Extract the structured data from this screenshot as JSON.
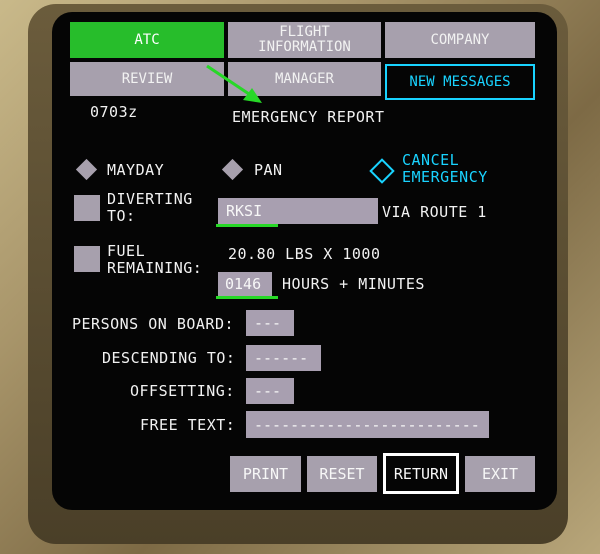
{
  "tabs": {
    "atc": "ATC",
    "flight_info_line1": "FLIGHT",
    "flight_info_line2": "INFORMATION",
    "company": "COMPANY",
    "review": "REVIEW",
    "manager": "MANAGER",
    "new_messages": "NEW MESSAGES"
  },
  "header": {
    "time": "0703z",
    "title": "EMERGENCY REPORT"
  },
  "options": {
    "mayday": "MAYDAY",
    "pan": "PAN",
    "cancel_line1": "CANCEL",
    "cancel_line2": "EMERGENCY"
  },
  "diverting": {
    "label_line1": "DIVERTING",
    "label_line2": "TO:",
    "value": "RKSI",
    "via": "VIA ROUTE 1"
  },
  "fuel": {
    "label_line1": "FUEL",
    "label_line2": "REMAINING:",
    "amount": "20.80 LBS X 1000",
    "time_value": "0146",
    "time_unit": "HOURS + MINUTES"
  },
  "fields": {
    "persons_label": "PERSONS ON BOARD:",
    "persons_value": "---",
    "descending_label": "DESCENDING TO:",
    "descending_value": "------",
    "offsetting_label": "OFFSETTING:",
    "offsetting_value": "---",
    "free_text_label": "FREE TEXT:",
    "free_text_value": "-------------------------"
  },
  "buttons": {
    "print": "PRINT",
    "reset": "RESET",
    "return": "RETURN",
    "exit": "EXIT"
  },
  "colors": {
    "accent": "#19d3ff",
    "active_tab": "#27bd2b",
    "field": "#a89fb0",
    "annotation": "#27d827"
  }
}
